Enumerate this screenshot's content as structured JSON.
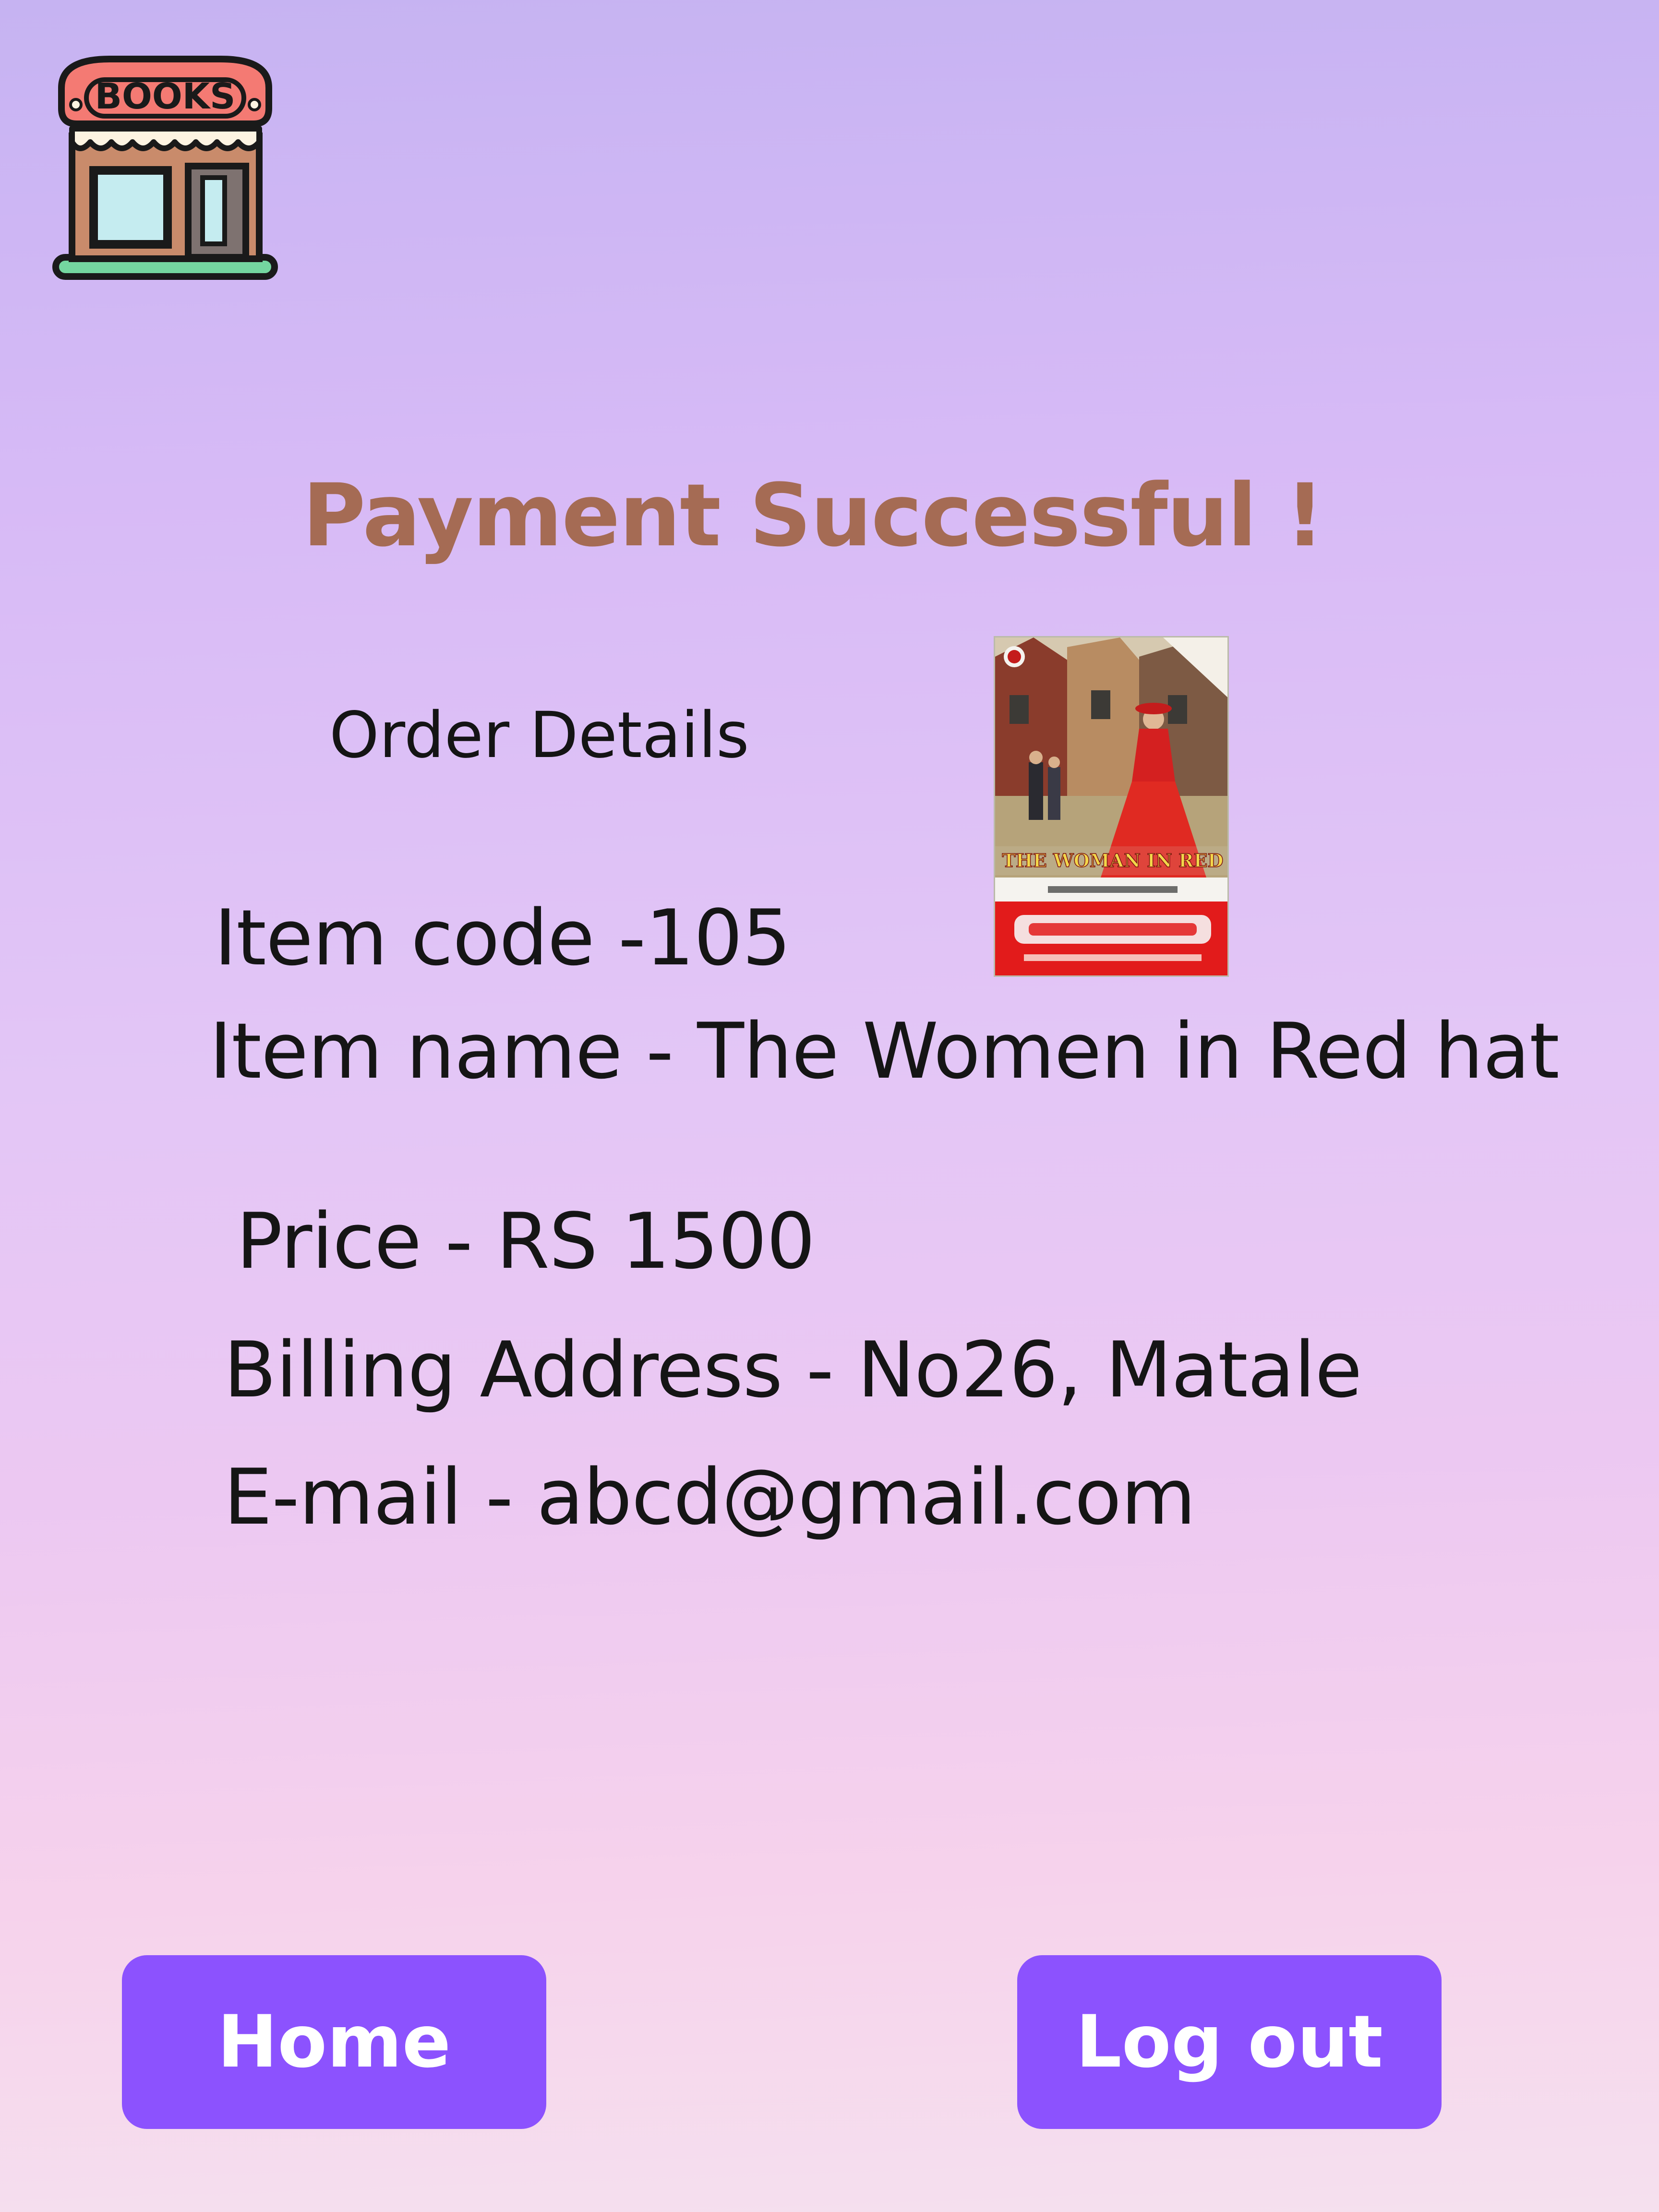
{
  "logo": {
    "sign_text": "BOOKS",
    "icon": "bookstore-icon"
  },
  "page": {
    "title": "Payment Successful !",
    "subtitle": "Order Details"
  },
  "order": {
    "item_code": "Item code -105",
    "item_name": "Item name - The Women in Red hat",
    "price": "Price - RS 1500",
    "billing_address": "Billing Address - No26, Matale",
    "email": "E-mail - abcd@gmail.com"
  },
  "book_cover": {
    "cover_title": "THE WOMAN IN RED"
  },
  "buttons": {
    "home": "Home",
    "logout": "Log out"
  },
  "colors": {
    "title": "#a56b54",
    "button": "#8c52fe",
    "text": "#151515",
    "background_top": "#c6b3f2",
    "background_bottom": "#f5e0ee"
  }
}
